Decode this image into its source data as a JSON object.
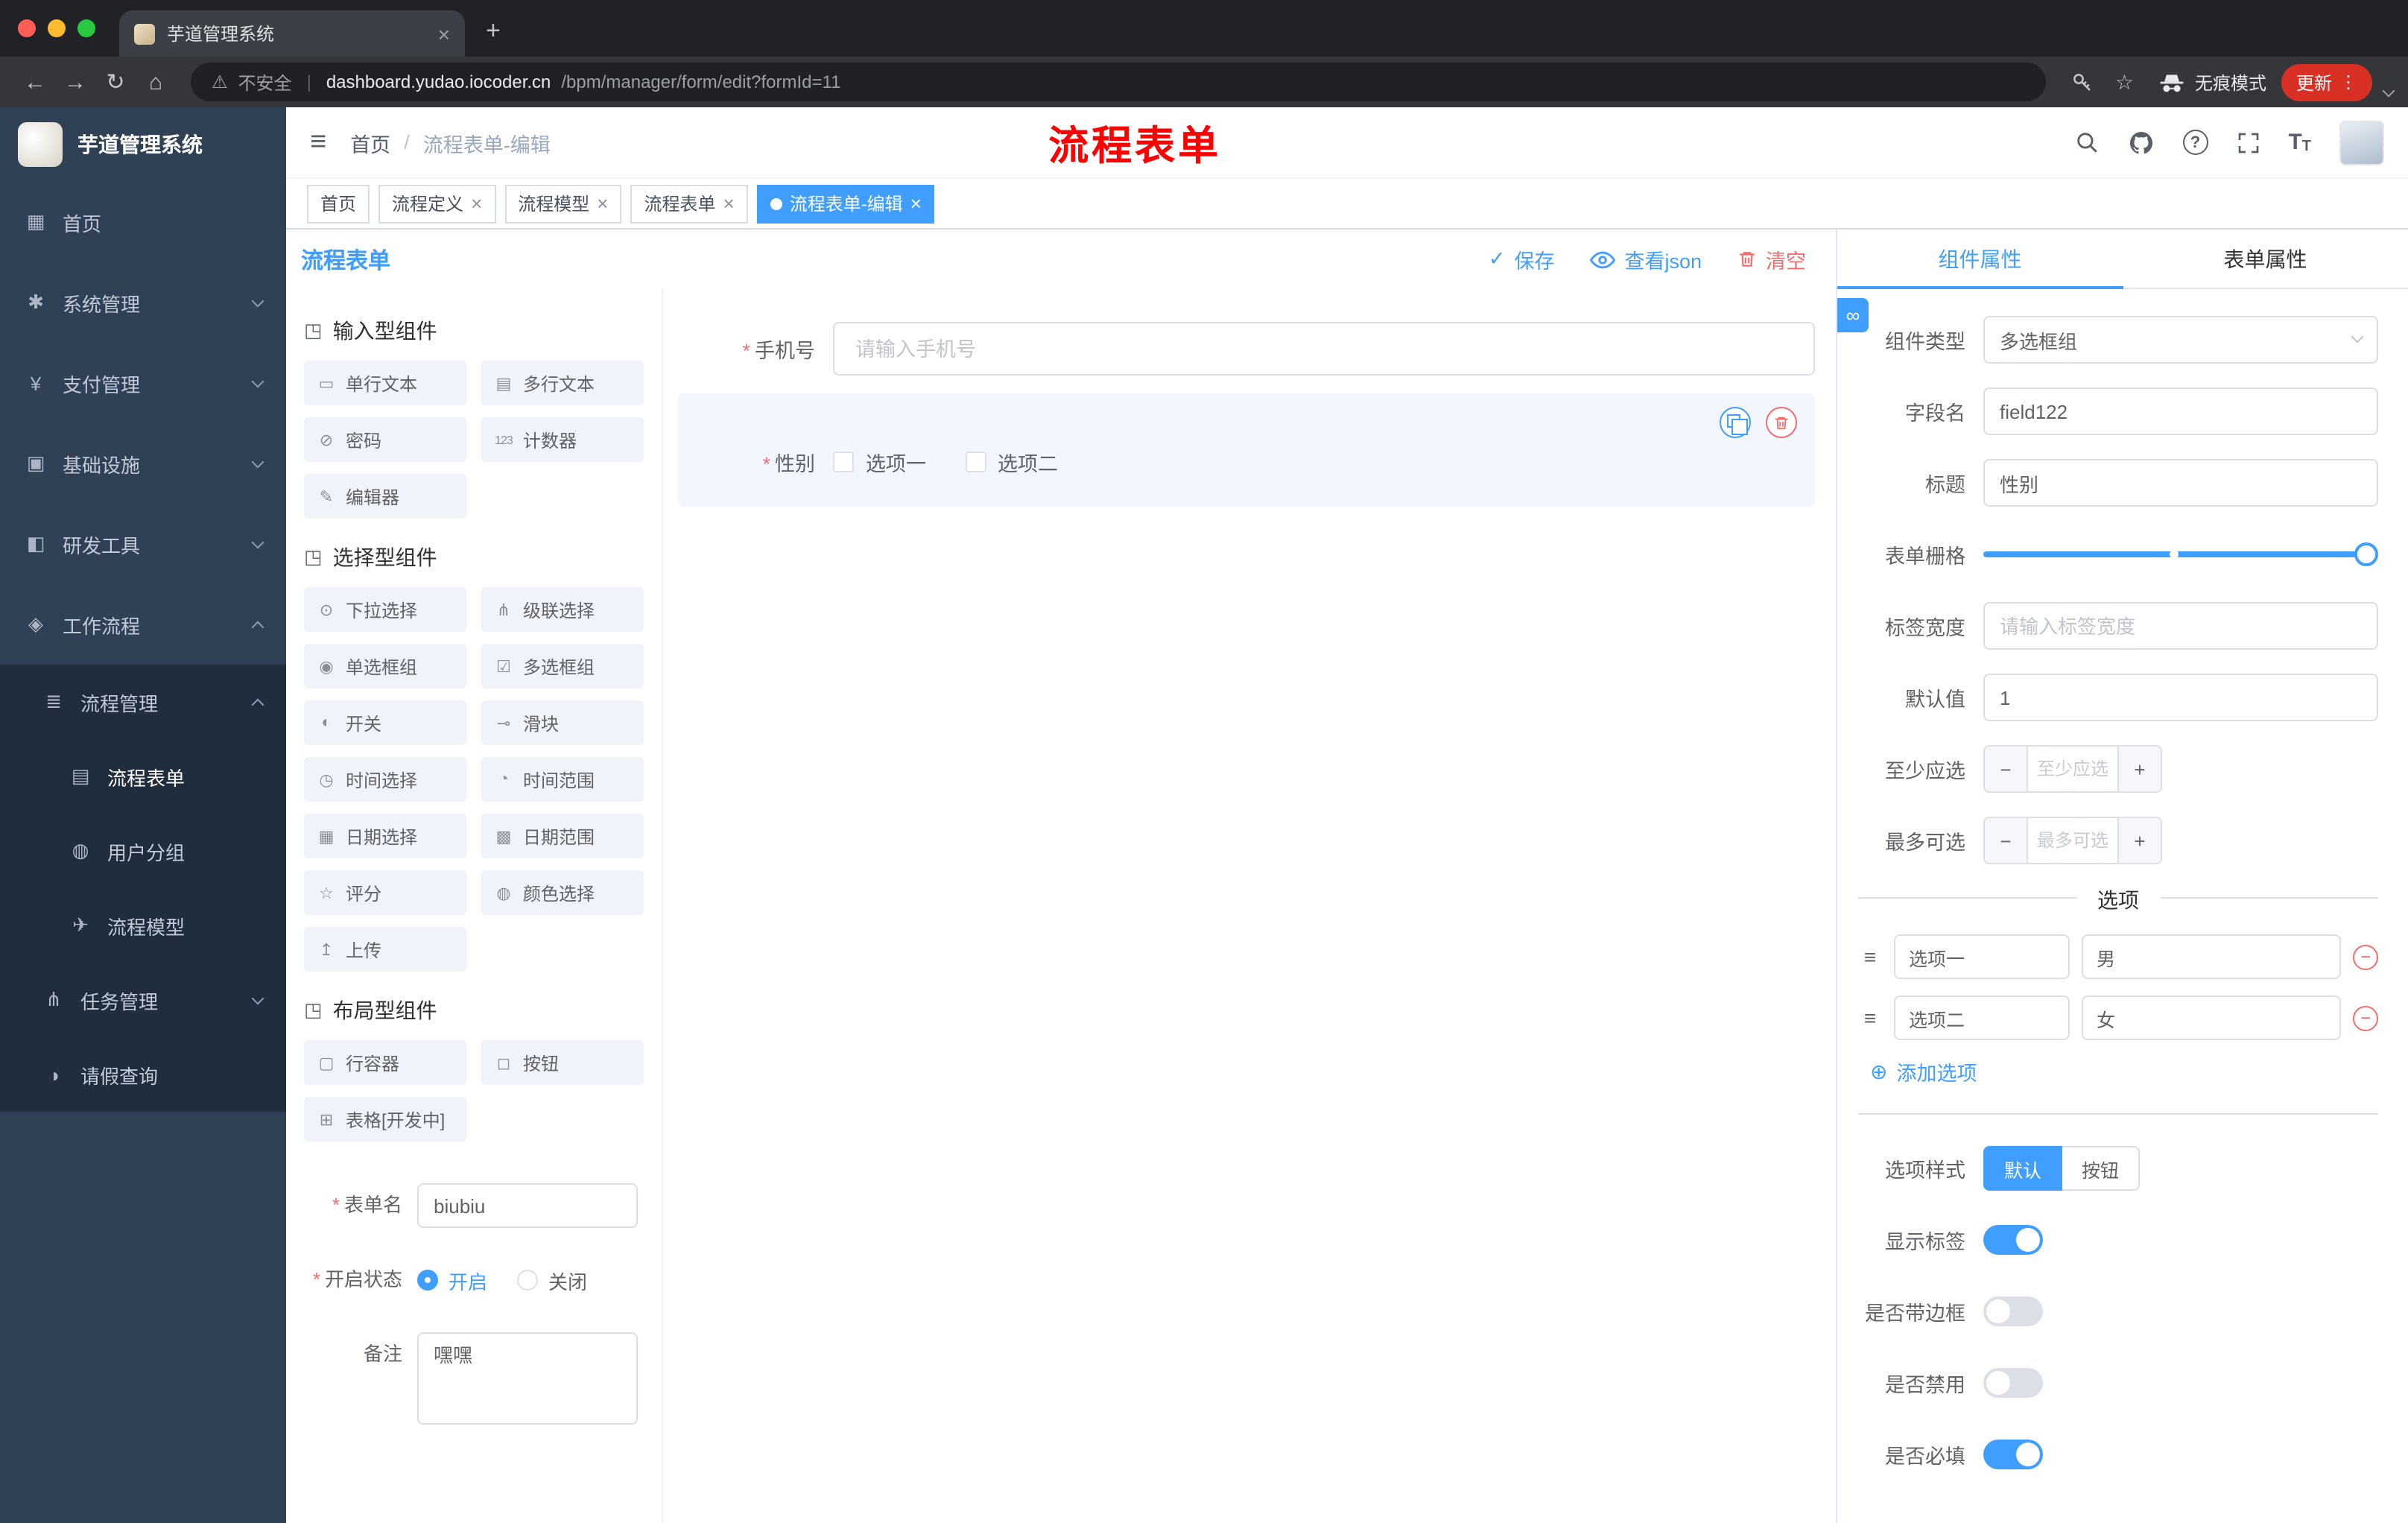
{
  "ui": {
    "required_mark": "*",
    "breadcrumb_sep": "/",
    "url_sep": "|",
    "plus": "+",
    "minus": "−",
    "close": "×",
    "hamburger": "≡",
    "check": "✓",
    "link_icon": "∞",
    "add_icon": "⊕",
    "handle_icon": "≡",
    "help": "?",
    "font_icon": "T",
    "menu_dots": "⋮",
    "back": "←",
    "forward": "→",
    "reload": "↻",
    "home": "⌂",
    "warning": "⚠",
    "star": "☆"
  },
  "colors": {
    "accent": "#409EFF",
    "danger": "#F56C6C",
    "annotation": "#FF0000",
    "sidebar_bg": "#304156",
    "sidebar_sub_bg": "#1F2D3D"
  },
  "browser": {
    "tab_title": "芋道管理系统",
    "security_text": "不安全",
    "url_host": "dashboard.yudao.iocoder.cn",
    "url_path": "/bpm/manager/form/edit?formId=11",
    "incognito_label": "无痕模式",
    "update_label": "更新"
  },
  "sidebar": {
    "logo_title": "芋道管理系统",
    "items": [
      {
        "icon": "▦",
        "label": "首页"
      },
      {
        "icon": "✱",
        "label": "系统管理"
      },
      {
        "icon": "¥",
        "label": "支付管理"
      },
      {
        "icon": "▣",
        "label": "基础设施"
      },
      {
        "icon": "◧",
        "label": "研发工具"
      },
      {
        "icon": "◈",
        "label": "工作流程"
      },
      {
        "icon": "≣",
        "label": "流程管理"
      },
      {
        "icon": "▤",
        "label": "流程表单"
      },
      {
        "icon": "◍",
        "label": "用户分组"
      },
      {
        "icon": "✈",
        "label": "流程模型"
      },
      {
        "icon": "⋔",
        "label": "任务管理"
      },
      {
        "icon": "◑",
        "label": "请假查询"
      }
    ]
  },
  "header": {
    "breadcrumb_home": "首页",
    "breadcrumb_current": "流程表单-编辑",
    "annotation": "流程表单"
  },
  "tags": [
    {
      "label": "首页"
    },
    {
      "label": "流程定义"
    },
    {
      "label": "流程模型"
    },
    {
      "label": "流程表单"
    },
    {
      "label": "流程表单-编辑"
    }
  ],
  "designer": {
    "title": "流程表单",
    "actions": {
      "save": "保存",
      "view_json": "查看json",
      "clear": "清空"
    },
    "palette": {
      "sections": [
        {
          "icon": "◳",
          "title": "输入型组件",
          "items": [
            {
              "icon": "▭",
              "label": "单行文本"
            },
            {
              "icon": "▤",
              "label": "多行文本"
            },
            {
              "icon": "⊘",
              "label": "密码"
            },
            {
              "icon": "123",
              "label": "计数器"
            },
            {
              "icon": "✎",
              "label": "编辑器"
            }
          ]
        },
        {
          "icon": "◳",
          "title": "选择型组件",
          "items": [
            {
              "icon": "⊙",
              "label": "下拉选择"
            },
            {
              "icon": "⋔",
              "label": "级联选择"
            },
            {
              "icon": "◉",
              "label": "单选框组"
            },
            {
              "icon": "☑",
              "label": "多选框组"
            },
            {
              "icon": "◐",
              "label": "开关"
            },
            {
              "icon": "⊸",
              "label": "滑块"
            },
            {
              "icon": "◷",
              "label": "时间选择"
            },
            {
              "icon": "◔",
              "label": "时间范围"
            },
            {
              "icon": "▦",
              "label": "日期选择"
            },
            {
              "icon": "▩",
              "label": "日期范围"
            },
            {
              "icon": "☆",
              "label": "评分"
            },
            {
              "icon": "◍",
              "label": "颜色选择"
            },
            {
              "icon": "↥",
              "label": "上传"
            }
          ]
        },
        {
          "icon": "◳",
          "title": "布局型组件",
          "items": [
            {
              "icon": "▢",
              "label": "行容器"
            },
            {
              "icon": "◻",
              "label": "按钮"
            },
            {
              "icon": "⊞",
              "label": "表格[开发中]"
            }
          ]
        }
      ]
    },
    "meta": {
      "name_label": "表单名",
      "name_value": "biubiu",
      "status_label": "开启状态",
      "status_on": "开启",
      "status_off": "关闭",
      "remark_label": "备注",
      "remark_value": "嘿嘿"
    },
    "canvas": {
      "phone_label": "手机号",
      "phone_placeholder": "请输入手机号",
      "gender_label": "性别",
      "gender_opt1": "选项一",
      "gender_opt2": "选项二"
    }
  },
  "props": {
    "tab_component": "组件属性",
    "tab_form": "表单属性",
    "component_type_label": "组件类型",
    "component_type_value": "多选框组",
    "field_name_label": "字段名",
    "field_name_value": "field122",
    "title_label": "标题",
    "title_value": "性别",
    "grid_label": "表单栅格",
    "label_width_label": "标签宽度",
    "label_width_placeholder": "请输入标签宽度",
    "default_label": "默认值",
    "default_value": "1",
    "min_label": "至少应选",
    "min_placeholder": "至少应选",
    "max_label": "最多可选",
    "max_placeholder": "最多可选",
    "options_title": "选项",
    "options": [
      {
        "label": "选项一",
        "value": "男"
      },
      {
        "label": "选项二",
        "value": "女"
      }
    ],
    "add_option": "添加选项",
    "style_label": "选项样式",
    "style_default": "默认",
    "style_button": "按钮",
    "toggle_show_label": "显示标签",
    "toggle_border": "是否带边框",
    "toggle_disabled": "是否禁用",
    "toggle_required": "是否必填"
  }
}
